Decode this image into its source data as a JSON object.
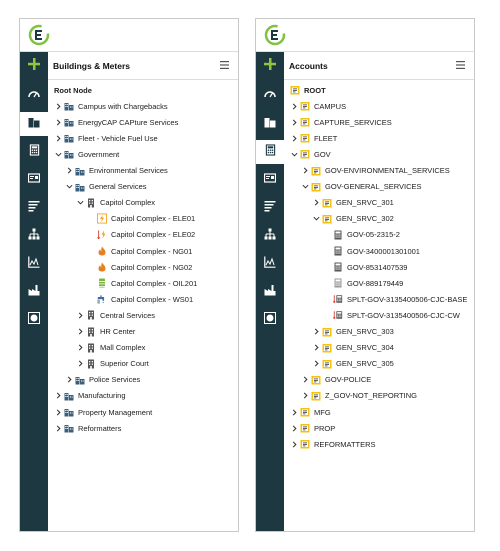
{
  "left_panel": {
    "header_title": "Buildings & Meters",
    "tree": [
      {
        "label": "Root Node",
        "level": 0,
        "chevron": "none",
        "icon": "none",
        "bold": true
      },
      {
        "label": "Campus with Chargebacks",
        "level": 0,
        "chevron": "right",
        "icon": "buildings-icon"
      },
      {
        "label": "EnergyCAP CAPture Services",
        "level": 0,
        "chevron": "right",
        "icon": "buildings-icon"
      },
      {
        "label": "Fleet - Vehicle Fuel Use",
        "level": 0,
        "chevron": "right",
        "icon": "buildings-icon"
      },
      {
        "label": "Government",
        "level": 0,
        "chevron": "down",
        "icon": "buildings-icon"
      },
      {
        "label": "Environmental Services",
        "level": 1,
        "chevron": "right",
        "icon": "buildings-icon"
      },
      {
        "label": "General Services",
        "level": 1,
        "chevron": "down",
        "icon": "buildings-icon"
      },
      {
        "label": "Capitol Complex",
        "level": 2,
        "chevron": "down",
        "icon": "building-icon"
      },
      {
        "label": "Capitol Complex - ELE01",
        "level": 3,
        "chevron": "none",
        "icon": "electric-meter-icon"
      },
      {
        "label": "Capitol Complex - ELE02",
        "level": 3,
        "chevron": "none",
        "icon": "electric-split-meter-icon"
      },
      {
        "label": "Capitol Complex - NG01",
        "level": 3,
        "chevron": "none",
        "icon": "gas-flame-icon"
      },
      {
        "label": "Capitol Complex - NG02",
        "level": 3,
        "chevron": "none",
        "icon": "gas-flame-icon"
      },
      {
        "label": "Capitol Complex - OIL201",
        "level": 3,
        "chevron": "none",
        "icon": "oil-tank-icon"
      },
      {
        "label": "Capitol Complex - WS01",
        "level": 3,
        "chevron": "none",
        "icon": "water-tap-icon"
      },
      {
        "label": "Central Services",
        "level": 2,
        "chevron": "right",
        "icon": "building-icon"
      },
      {
        "label": "HR Center",
        "level": 2,
        "chevron": "right",
        "icon": "building-icon"
      },
      {
        "label": "Mall Complex",
        "level": 2,
        "chevron": "right",
        "icon": "building-icon"
      },
      {
        "label": "Superior Court",
        "level": 2,
        "chevron": "right",
        "icon": "building-icon"
      },
      {
        "label": "Police Services",
        "level": 1,
        "chevron": "right",
        "icon": "buildings-icon"
      },
      {
        "label": "Manufacturing",
        "level": 0,
        "chevron": "right",
        "icon": "buildings-icon"
      },
      {
        "label": "Property Management",
        "level": 0,
        "chevron": "right",
        "icon": "buildings-icon"
      },
      {
        "label": "Reformatters",
        "level": 0,
        "chevron": "right",
        "icon": "buildings-icon"
      }
    ]
  },
  "right_panel": {
    "header_title": "Accounts",
    "tree": [
      {
        "label": "ROOT",
        "level": 0,
        "chevron": "none",
        "icon": "folder-icon",
        "bold": true
      },
      {
        "label": "CAMPUS",
        "level": 0,
        "chevron": "right",
        "icon": "folder-icon"
      },
      {
        "label": "CAPTURE_SERVICES",
        "level": 0,
        "chevron": "right",
        "icon": "folder-icon"
      },
      {
        "label": "FLEET",
        "level": 0,
        "chevron": "right",
        "icon": "folder-icon"
      },
      {
        "label": "GOV",
        "level": 0,
        "chevron": "down",
        "icon": "folder-icon"
      },
      {
        "label": "GOV-ENVIRONMENTAL_SERVICES",
        "level": 1,
        "chevron": "right",
        "icon": "folder-icon"
      },
      {
        "label": "GOV-GENERAL_SERVICES",
        "level": 1,
        "chevron": "down",
        "icon": "folder-icon"
      },
      {
        "label": "GEN_SRVC_301",
        "level": 2,
        "chevron": "right",
        "icon": "folder-icon"
      },
      {
        "label": "GEN_SRVC_302",
        "level": 2,
        "chevron": "down",
        "icon": "folder-icon"
      },
      {
        "label": "GOV-05-2315-2",
        "level": 3,
        "chevron": "none",
        "icon": "calculator-icon"
      },
      {
        "label": "GOV-3400001301001",
        "level": 3,
        "chevron": "none",
        "icon": "calculator-icon"
      },
      {
        "label": "GOV-8531407539",
        "level": 3,
        "chevron": "none",
        "icon": "calculator-icon"
      },
      {
        "label": "GOV-889179449",
        "level": 3,
        "chevron": "none",
        "icon": "calculator-light-icon"
      },
      {
        "label": "SPLT-GOV-3135400506-CJC-BASE",
        "level": 3,
        "chevron": "none",
        "icon": "split-account-icon"
      },
      {
        "label": "SPLT-GOV-3135400506-CJC-CW",
        "level": 3,
        "chevron": "none",
        "icon": "split-account-icon"
      },
      {
        "label": "GEN_SRVC_303",
        "level": 2,
        "chevron": "right",
        "icon": "folder-icon"
      },
      {
        "label": "GEN_SRVC_304",
        "level": 2,
        "chevron": "right",
        "icon": "folder-icon"
      },
      {
        "label": "GEN_SRVC_305",
        "level": 2,
        "chevron": "right",
        "icon": "folder-icon"
      },
      {
        "label": "GOV-POLICE",
        "level": 1,
        "chevron": "right",
        "icon": "folder-icon"
      },
      {
        "label": "Z_GOV-NOT_REPORTING",
        "level": 1,
        "chevron": "right",
        "icon": "folder-icon"
      },
      {
        "label": "MFG",
        "level": 0,
        "chevron": "right",
        "icon": "folder-icon"
      },
      {
        "label": "PROP",
        "level": 0,
        "chevron": "right",
        "icon": "folder-icon"
      },
      {
        "label": "REFORMATTERS",
        "level": 0,
        "chevron": "right",
        "icon": "folder-icon"
      }
    ]
  },
  "rail": {
    "left_active": "buildings-nav-icon",
    "right_active": "calculator-nav-icon",
    "items": [
      "add-icon",
      "dashboard-icon",
      "buildings-nav-icon",
      "calculator-nav-icon",
      "bill-icon",
      "reports-icon",
      "org-chart-icon",
      "chart-icon",
      "factory-icon",
      "globe-icon"
    ]
  },
  "colors": {
    "rail": "#1e3841",
    "plus": "#8dc63f",
    "folder": "#f4c20d",
    "electric": "#f39c12",
    "gas": "#e67e22",
    "oil": "#7cb342",
    "water": "#3b6ea5",
    "split_red": "#d9342b",
    "calc": "#555555"
  }
}
